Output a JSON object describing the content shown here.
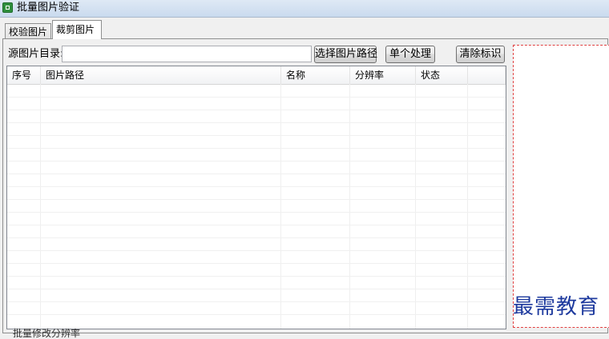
{
  "window": {
    "title": "批量图片验证"
  },
  "tabs": [
    {
      "label": "校验图片",
      "active": false
    },
    {
      "label": "裁剪图片",
      "active": true
    }
  ],
  "source": {
    "label": "源图片目录:",
    "value": ""
  },
  "buttons": {
    "select_path": "选择图片路径",
    "single_process": "单个处理",
    "clear_marks": "清除标识"
  },
  "table": {
    "columns": [
      "序号",
      "图片路径",
      "名称",
      "分辨率",
      "状态"
    ],
    "rows": []
  },
  "watermark": "最需教育",
  "status_text": "批量修改分辨率",
  "colors": {
    "preview_border": "#e04040",
    "watermark": "#1e3a9e"
  }
}
